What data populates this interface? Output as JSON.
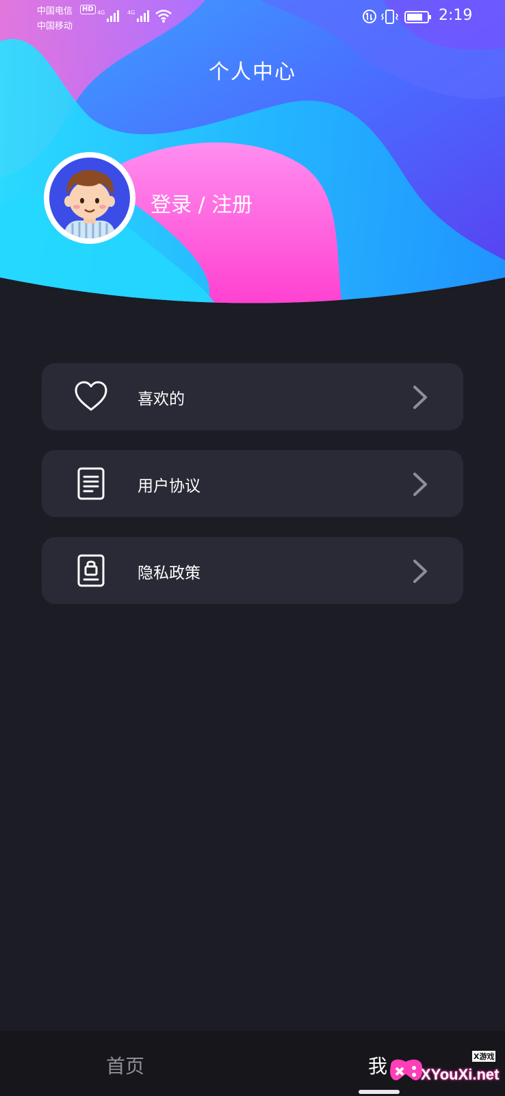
{
  "status_bar": {
    "carrier_1": "中国电信",
    "hd_badge": "HD",
    "carrier_2": "中国移动",
    "network_1": "4G",
    "network_2": "4G",
    "time": "2:19",
    "icons": [
      "signal-icon",
      "signal-icon",
      "wifi-icon",
      "data-saver-icon",
      "vibrate-icon",
      "battery-icon"
    ]
  },
  "header": {
    "title": "个人中心",
    "login_label": "登录 / 注册"
  },
  "menu": {
    "items": [
      {
        "label": "喜欢的",
        "icon": "heart-icon"
      },
      {
        "label": "用户协议",
        "icon": "document-icon"
      },
      {
        "label": "隐私政策",
        "icon": "privacy-lock-icon"
      }
    ]
  },
  "tabbar": {
    "tabs": [
      {
        "label": "首页",
        "active": false
      },
      {
        "label": "我",
        "active": true
      }
    ]
  },
  "watermark": {
    "small_text": "X游戏",
    "text": "XYouXi.net"
  },
  "colors": {
    "background": "#1b1c24",
    "card": "#292a35",
    "tabbar": "#16161b",
    "inactive_tab": "#8f9099",
    "avatar_bg": "#3b4de6",
    "accent_pink": "#ff4fd8",
    "accent_cyan": "#2fd6ff"
  }
}
